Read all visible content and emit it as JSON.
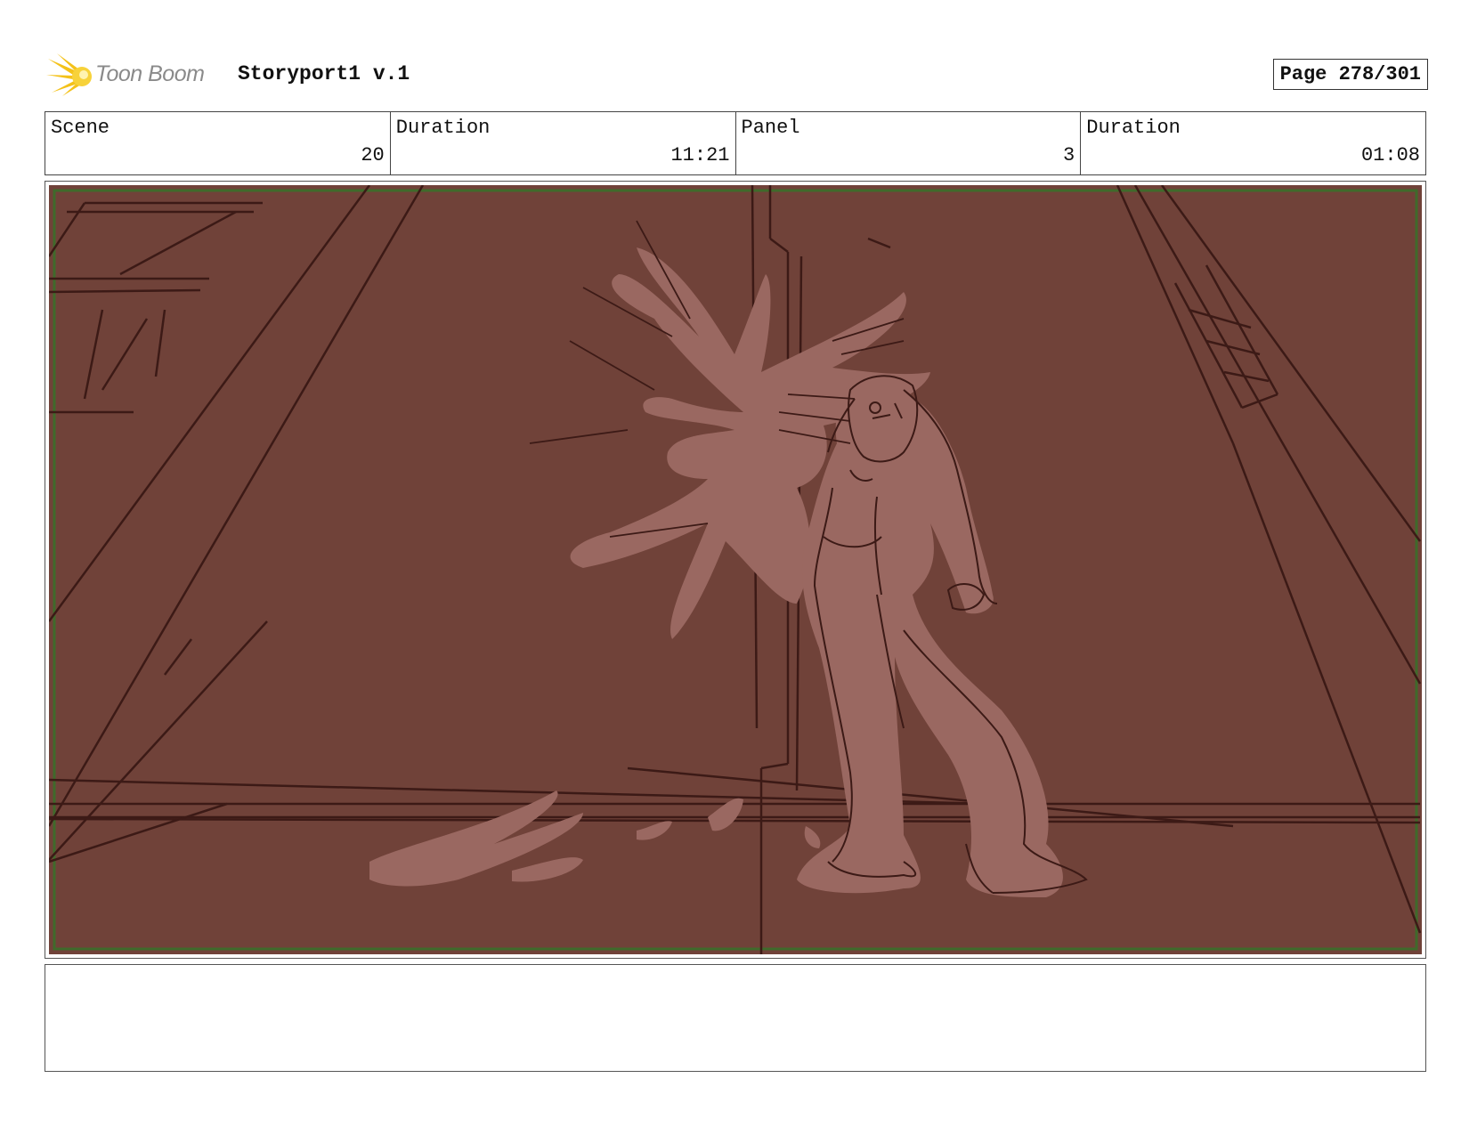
{
  "header": {
    "logo_text": "Toon Boom",
    "app_title": "Storyport1 v.1",
    "page_label": "Page 278/301"
  },
  "info": {
    "scene_label": "Scene",
    "scene_value": "20",
    "scene_duration_label": "Duration",
    "scene_duration_value": "11:21",
    "panel_label": "Panel",
    "panel_value": "3",
    "panel_duration_label": "Duration",
    "panel_duration_value": "01:08"
  },
  "notes": {
    "text": ""
  },
  "colors": {
    "panel_background": "#704239",
    "sketch_line": "#3c1a16",
    "sketch_fill": "#9a6861",
    "safe_frame": "#3f6a2b",
    "logo_yellow": "#f4c21a"
  }
}
